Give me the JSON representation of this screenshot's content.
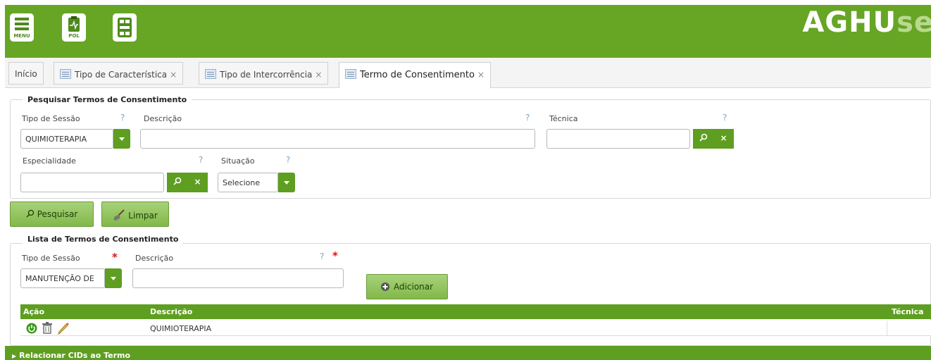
{
  "header": {
    "menu_label": "MENU",
    "pol_label": "POL",
    "brand_main": "AGHU",
    "brand_sub": "se"
  },
  "tabs": [
    {
      "label": "Início"
    },
    {
      "label": "Tipo de Característica",
      "close": "×"
    },
    {
      "label": "Tipo de Intercorrência",
      "close": "×"
    },
    {
      "label": "Termo de Consentimento",
      "close": "×"
    }
  ],
  "search": {
    "legend": "Pesquisar Termos de Consentimento",
    "tipo_sessao_label": "Tipo de Sessão",
    "tipo_sessao_value": "QUIMIOTERAPIA",
    "descricao_label": "Descrição",
    "descricao_value": "",
    "tecnica_label": "Técnica",
    "tecnica_value": "",
    "especialidade_label": "Especialidade",
    "especialidade_value": "",
    "situacao_label": "Situação",
    "situacao_value": "Selecione",
    "help": "?",
    "clear_glyph": "×"
  },
  "actions": {
    "pesquisar": "Pesquisar",
    "limpar": "Limpar"
  },
  "list": {
    "legend": "Lista de Termos de Consentimento",
    "tipo_sessao_label": "Tipo de Sessão",
    "tipo_sessao_value": "MANUTENÇÃO DE",
    "descricao_label": "Descrição",
    "descricao_value": "",
    "required": "*",
    "help": "?",
    "adicionar": "Adicionar"
  },
  "grid": {
    "columns": [
      "Ação",
      "Descrição",
      "Técnica"
    ],
    "rows": [
      {
        "descricao": "QUIMIOTERAPIA",
        "tecnica": ""
      }
    ]
  },
  "footer": {
    "relacionar": "Relacionar CIDs ao Termo"
  },
  "colors": {
    "brand_green": "#67a525",
    "button_green": "#5e9e20"
  }
}
